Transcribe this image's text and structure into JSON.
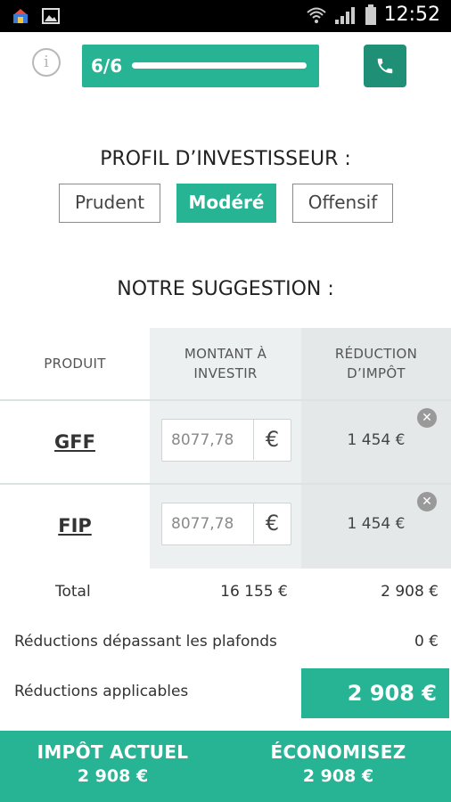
{
  "status_bar": {
    "time": "12:52"
  },
  "header": {
    "progress_label": "6/6",
    "progress_fraction": 1.0
  },
  "profile": {
    "title": "PROFIL D’INVESTISSEUR :",
    "options": [
      {
        "label": "Prudent",
        "selected": false
      },
      {
        "label": "Modéré",
        "selected": true
      },
      {
        "label": "Offensif",
        "selected": false
      }
    ]
  },
  "suggestion": {
    "title": "NOTRE SUGGESTION :",
    "columns": [
      "PRODUIT",
      "MONTANT À INVESTIR",
      "RÉDUCTION D’IMPÔT"
    ],
    "rows": [
      {
        "product": "GFF",
        "amount": "8077,78",
        "currency": "€",
        "reduction": "1 454 €"
      },
      {
        "product": "FIP",
        "amount": "8077,78",
        "currency": "€",
        "reduction": "1 454 €"
      }
    ]
  },
  "totals": {
    "total_label": "Total",
    "total_amount": "16 155 €",
    "total_reduction": "2 908 €",
    "over_label": "Réductions dépassant les plafonds",
    "over_value": "0 €",
    "applicable_label": "Réductions applicables",
    "applicable_value": "2 908 €"
  },
  "footer": {
    "current_tax_label": "IMPÔT ACTUEL",
    "current_tax_value": "2 908 €",
    "savings_label": "ÉCONOMISEZ",
    "savings_value": "2 908 €"
  },
  "colors": {
    "accent": "#27b495",
    "accent_dark": "#1f8f75"
  }
}
